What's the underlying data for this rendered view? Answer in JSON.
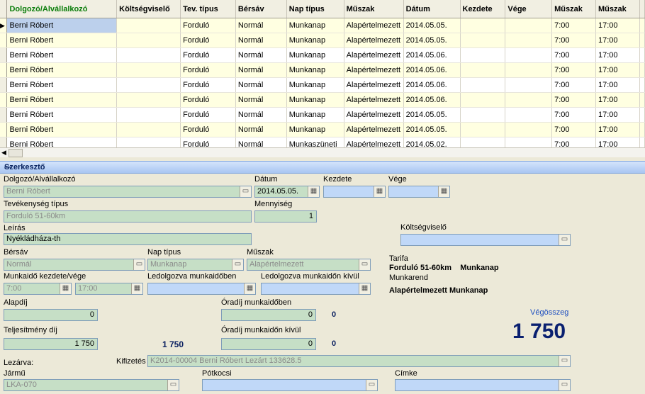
{
  "grid": {
    "columns": [
      "Dolgozó/Alvállalkozó",
      "Költségviselő",
      "Tev. típus",
      "Bérsáv",
      "Nap típus",
      "Műszak",
      "Dátum",
      "Kezdete",
      "Vége",
      "Műszak",
      "Műszak"
    ],
    "rows": [
      [
        "Berni Róbert",
        "",
        "Forduló",
        "Normál",
        "Munkanap",
        "Alapértelmezett",
        "2014.05.05.",
        "",
        "",
        "7:00",
        "17:00"
      ],
      [
        "Berni Róbert",
        "",
        "Forduló",
        "Normál",
        "Munkanap",
        "Alapértelmezett",
        "2014.05.05.",
        "",
        "",
        "7:00",
        "17:00"
      ],
      [
        "Berni Róbert",
        "",
        "Forduló",
        "Normál",
        "Munkanap",
        "Alapértelmezett",
        "2014.05.06.",
        "",
        "",
        "7:00",
        "17:00"
      ],
      [
        "Berni Róbert",
        "",
        "Forduló",
        "Normál",
        "Munkanap",
        "Alapértelmezett",
        "2014.05.06.",
        "",
        "",
        "7:00",
        "17:00"
      ],
      [
        "Berni Róbert",
        "",
        "Forduló",
        "Normál",
        "Munkanap",
        "Alapértelmezett",
        "2014.05.06.",
        "",
        "",
        "7:00",
        "17:00"
      ],
      [
        "Berni Róbert",
        "",
        "Forduló",
        "Normál",
        "Munkanap",
        "Alapértelmezett",
        "2014.05.06.",
        "",
        "",
        "7:00",
        "17:00"
      ],
      [
        "Berni Róbert",
        "",
        "Forduló",
        "Normál",
        "Munkanap",
        "Alapértelmezett",
        "2014.05.05.",
        "",
        "",
        "7:00",
        "17:00"
      ],
      [
        "Berni Róbert",
        "",
        "Forduló",
        "Normál",
        "Munkanap",
        "Alapértelmezett",
        "2014.05.05.",
        "",
        "",
        "7:00",
        "17:00"
      ],
      [
        "Berni Róbert",
        "",
        "Forduló",
        "Normál",
        "Munkaszüneti",
        "Alapértelmezett",
        "2014.05.02.",
        "",
        "",
        "7:00",
        "17:00"
      ]
    ]
  },
  "editor": {
    "section_title": "Szerkesztő",
    "employee_label": "Dolgozó/Alvállalkozó",
    "employee_value": "Berni Róbert",
    "date_label": "Dátum",
    "date_value": "2014.05.05.",
    "start_label": "Kezdete",
    "end_label": "Vége",
    "activity_label": "Tevékenység típus",
    "activity_value": "Forduló 51-60km",
    "quantity_label": "Mennyiség",
    "quantity_value": "1",
    "description_label": "Leírás",
    "description_value": "Nyékládháza-th",
    "cost_bearer_label": "Költségviselő",
    "wage_band_label": "Bérsáv",
    "wage_band_value": "Normál",
    "day_type_label": "Nap típus",
    "day_type_value": "Munkanap",
    "shift_label": "Műszak",
    "shift_value": "Alapértelmezett",
    "tariff_label": "Tarifa",
    "tariff_value": "Forduló 51-60km    Munkanap",
    "work_order_label": "Munkarend",
    "work_order_value": "Alapértelmezett Munkanap",
    "worktime_label": "Munkaidő kezdete/vége",
    "worktime_start": "7:00",
    "worktime_end": "17:00",
    "in_worktime_label": "Ledolgozva munkaidőben",
    "out_worktime_label": "Ledolgozva munkaidőn kívül",
    "base_fee_label": "Alapdíj",
    "base_fee_value": "0",
    "hourly_in_label": "Óradíj munkaidőben",
    "hourly_in_value": "0",
    "hourly_in_result": "0",
    "performance_fee_label": "Teljesítmény díj",
    "performance_fee_value": "1 750",
    "performance_fee_result": "1 750",
    "hourly_out_label": "Óradíj munkaidőn kívül",
    "hourly_out_value": "0",
    "hourly_out_result": "0",
    "total_label": "Végösszeg",
    "total_value": "1 750",
    "closing_label": "Lezárva:",
    "payment_label": "Kifizetés",
    "payment_value": "K2014-00004 Berni Róbert Lezárt 133628.5",
    "vehicle_label": "Jármű",
    "vehicle_value": "LKA-070",
    "trailer_label": "Pótkocsi",
    "tag_label": "Címke"
  },
  "icons": {
    "picker": "folder-picker-icon",
    "calendar": "calendar-icon"
  }
}
